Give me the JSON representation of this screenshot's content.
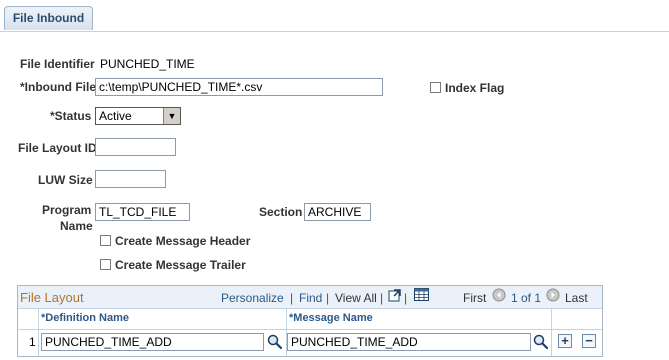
{
  "tabs": [
    {
      "label": "File Inbound"
    }
  ],
  "form": {
    "file_identifier_label": "File Identifier",
    "file_identifier_value": "PUNCHED_TIME",
    "inbound_file_label": "*Inbound File",
    "inbound_file_value": "c:\\temp\\PUNCHED_TIME*.csv",
    "index_flag_label": "Index Flag",
    "status_label": "*Status",
    "status_value": "Active",
    "file_layout_id_label": "File Layout ID",
    "file_layout_id_value": "",
    "luw_size_label": "LUW Size",
    "luw_size_value": "",
    "program_label_line1": "Program",
    "program_label_line2": "Name",
    "program_value": "TL_TCD_FILE",
    "section_label": "Section",
    "section_value": "ARCHIVE",
    "create_header_label": "Create Message Header",
    "create_trailer_label": "Create Message Trailer"
  },
  "grid": {
    "title": "File Layout",
    "personalize": "Personalize",
    "find": "Find",
    "sep": "|",
    "view_all": "View All",
    "first": "First",
    "range": "1 of 1",
    "last": "Last",
    "columns": [
      "*Definition Name",
      "*Message Name"
    ],
    "rows": [
      {
        "num": "1",
        "definition": "PUNCHED_TIME_ADD",
        "message": "PUNCHED_TIME_ADD"
      }
    ],
    "add_symbol": "+",
    "delete_symbol": "−"
  }
}
